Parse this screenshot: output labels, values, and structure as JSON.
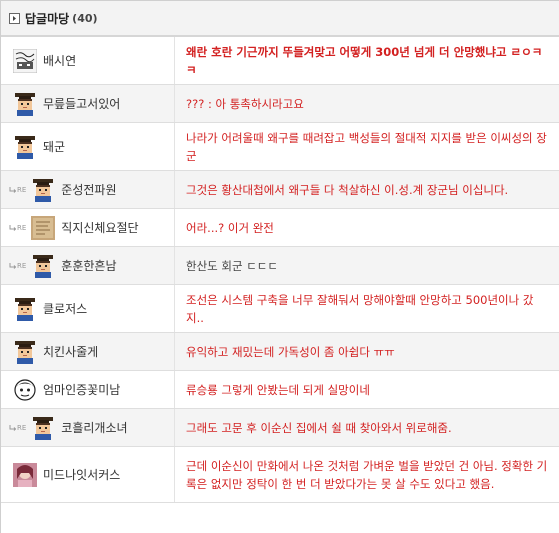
{
  "header": {
    "title": "답글마당",
    "count": "(40)"
  },
  "comments": [
    {
      "nick": "배시연",
      "text": "왜란 호란 기근까지 뚜들겨맞고 어떻게 300년 넘게 더 안망했냐고 ㄹㅇㅋㅋ",
      "avatar": "scribble",
      "reply": false,
      "bold": true
    },
    {
      "nick": "무릎들고서있어",
      "text": "??? : 아 통촉하시라고요",
      "avatar": "scholar",
      "reply": false,
      "bold": false
    },
    {
      "nick": "돼군",
      "text": "나라가 어려울때 왜구를 때려잡고 백성들의 절대적 지지를 받은 이씨성의 장군",
      "avatar": "scholar",
      "reply": false,
      "bold": false
    },
    {
      "nick": "준성전파원",
      "text": "그것은 황산대첩에서 왜구들 다 척살하신 이.성.계 장군님 이십니다.",
      "avatar": "scholar",
      "reply": true,
      "bold": false
    },
    {
      "nick": "직지신체요절단",
      "text": "어라...? 이거 완전",
      "avatar": "paper",
      "reply": true,
      "bold": false
    },
    {
      "nick": "훈훈한흔남",
      "text": "한산도 회군 ㄷㄷㄷ",
      "avatar": "scholar",
      "reply": true,
      "bold": false,
      "dim": true
    },
    {
      "nick": "클로저스",
      "text": "조선은 시스템 구축을 너무 잘해둬서 망해야할때 안망하고 500년이나 갔지..",
      "avatar": "scholar",
      "reply": false,
      "bold": false
    },
    {
      "nick": "치킨사줄게",
      "text": "유익하고 재밌는데 가독성이 좀 아쉽다 ㅠㅠ",
      "avatar": "scholar",
      "reply": false,
      "bold": false
    },
    {
      "nick": "엄마인증꽃미남",
      "text": "류승룡 그렇게 안봤는데 되게 실망이네",
      "avatar": "cartoon",
      "reply": false,
      "bold": false
    },
    {
      "nick": "코흘리개소녀",
      "text": "그래도 고문 후 이순신 집에서 쉴 때 찾아와서 위로해줌.",
      "avatar": "scholar",
      "reply": true,
      "bold": false
    },
    {
      "nick": "미드나잇서커스",
      "text": "근데 이순신이 만화에서 나온 것처럼 가벼운 벌을 받았던 건 아님. 정확한 기록은 없지만 정탁이 한 번 더 받았다가는 못 살 수도 있다고 했음.",
      "avatar": "photo",
      "reply": false,
      "bold": false
    }
  ],
  "re_label": "RE",
  "colors": {
    "comment_text": "#d32121",
    "alt_row": "#f4f4f4",
    "border": "#dedede"
  }
}
